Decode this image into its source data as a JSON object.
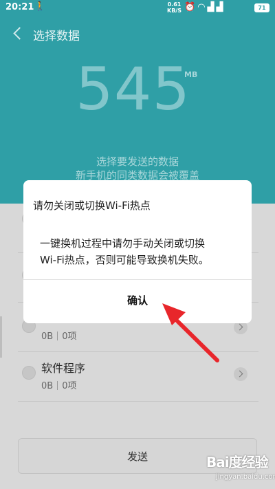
{
  "status_bar": {
    "time": "20:21",
    "net_speed_value": "0.61",
    "net_speed_unit": "KB/S",
    "battery": "71",
    "walk_icon": "walk-icon",
    "icons": [
      "alarm-icon",
      "wifi-icon",
      "signal-4g-icon",
      "signal-3g-icon",
      "battery-icon"
    ]
  },
  "header": {
    "title": "选择数据",
    "size_value": "545",
    "size_unit": "MB",
    "hint_line1": "选择要发送的数据",
    "hint_line2": "新手机的同类数据会被覆盖"
  },
  "list": {
    "items": [
      {
        "title": "",
        "size": "",
        "count": ""
      },
      {
        "title": "",
        "size": "",
        "count": ""
      },
      {
        "title": "",
        "size": "0B",
        "count": "0项"
      },
      {
        "title": "软件程序",
        "size": "0B",
        "count": "0项"
      }
    ],
    "send_label": "发送"
  },
  "dialog": {
    "title": "请勿关闭或切换Wi-Fi热点",
    "message_line1": "一键换机过程中请勿手动关闭或切换",
    "message_line2": "Wi-Fi热点，否则可能导致换机失败。",
    "confirm_label": "确认"
  },
  "watermark": {
    "logo": "Bai度经验",
    "url": "jingyan.baidu.com"
  },
  "colors": {
    "header_teal": "#2f9fa6",
    "annotation_red": "#e8262b"
  }
}
